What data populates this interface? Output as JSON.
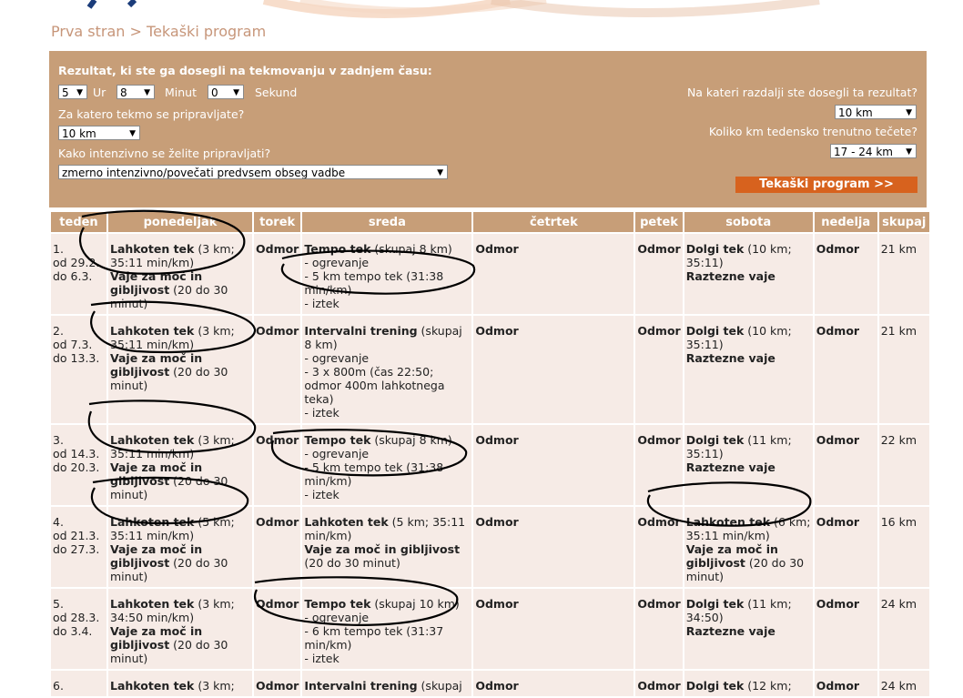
{
  "breadcrumb": {
    "home": "Prva stran",
    "separator": ">",
    "current": "Tekaški program"
  },
  "form": {
    "question_result": "Rezultat, ki ste ga dosegli na tekmovanju v zadnjem času:",
    "hours_value": "5",
    "hours_label": "Ur",
    "minutes_value": "8",
    "minutes_label": "Minut",
    "seconds_value": "0",
    "seconds_label": "Sekund",
    "question_race": "Za katero tekmo se pripravljate?",
    "race_value": "10 km",
    "question_intensity": "Kako intenzivno se želite pripravljati?",
    "intensity_value": "zmerno intenzivno/povečati predvsem obseg vadbe",
    "question_distance": "Na kateri razdalji ste dosegli ta rezultat?",
    "distance_value": "10 km",
    "question_weekly": "Koliko km tedensko trenutno tečete?",
    "weekly_value": "17 - 24 km",
    "submit_label": "Tekaški program >>"
  },
  "table": {
    "headers": [
      "teden",
      "ponedeljak",
      "torek",
      "sreda",
      "četrtek",
      "petek",
      "sobota",
      "nedelja",
      "skupaj"
    ],
    "rows": [
      {
        "week": [
          "1.",
          "od 29.2.",
          "do 6.3."
        ],
        "mon": [
          {
            "b": "Lahkoten tek",
            "t": " (3 km; 35:11 min/km)"
          },
          {
            "b": "Vaje za moč in gibljivost",
            "t": " (20 do 30 minut)"
          }
        ],
        "tue": [
          {
            "b": "Odmor",
            "t": ""
          }
        ],
        "wed": [
          {
            "b": "Tempo tek",
            "t": " (skupaj 8 km)"
          },
          {
            "b": "",
            "t": "- ogrevanje"
          },
          {
            "b": "",
            "t": "- 5 km tempo tek (31:38 min/km)"
          },
          {
            "b": "",
            "t": "- iztek"
          }
        ],
        "thu": [
          {
            "b": "Odmor",
            "t": ""
          }
        ],
        "fri": [
          {
            "b": "Odmor",
            "t": ""
          }
        ],
        "sat": [
          {
            "b": "Dolgi tek",
            "t": " (10 km; 35:11)"
          },
          {
            "b": "Raztezne vaje",
            "t": ""
          }
        ],
        "sun": [
          {
            "b": "Odmor",
            "t": ""
          }
        ],
        "total": "21 km"
      },
      {
        "week": [
          "2.",
          "od 7.3.",
          "do 13.3."
        ],
        "mon": [
          {
            "b": "Lahkoten tek",
            "t": " (3 km; 35:11 min/km)"
          },
          {
            "b": "Vaje za moč in gibljivost",
            "t": " (20 do 30 minut)"
          }
        ],
        "tue": [
          {
            "b": "Odmor",
            "t": ""
          }
        ],
        "wed": [
          {
            "b": "Intervalni trening",
            "t": " (skupaj 8 km)"
          },
          {
            "b": "",
            "t": "- ogrevanje"
          },
          {
            "b": "",
            "t": "- 3 x 800m (čas 22:50; odmor 400m lahkotnega teka)"
          },
          {
            "b": "",
            "t": "- iztek"
          }
        ],
        "thu": [
          {
            "b": "Odmor",
            "t": ""
          }
        ],
        "fri": [
          {
            "b": "Odmor",
            "t": ""
          }
        ],
        "sat": [
          {
            "b": "Dolgi tek",
            "t": " (10 km; 35:11)"
          },
          {
            "b": "Raztezne vaje",
            "t": ""
          }
        ],
        "sun": [
          {
            "b": "Odmor",
            "t": ""
          }
        ],
        "total": "21 km"
      },
      {
        "week": [
          "3.",
          "od 14.3.",
          "do 20.3."
        ],
        "mon": [
          {
            "b": "Lahkoten tek",
            "t": " (3 km; 35:11 min/km)"
          },
          {
            "b": "Vaje za moč in gibljivost",
            "t": " (20 do 30 minut)"
          }
        ],
        "tue": [
          {
            "b": "Odmor",
            "t": ""
          }
        ],
        "wed": [
          {
            "b": "Tempo tek",
            "t": " (skupaj 8 km)"
          },
          {
            "b": "",
            "t": "- ogrevanje"
          },
          {
            "b": "",
            "t": "- 5 km tempo tek (31:38 min/km)"
          },
          {
            "b": "",
            "t": "- iztek"
          }
        ],
        "thu": [
          {
            "b": "Odmor",
            "t": ""
          }
        ],
        "fri": [
          {
            "b": "Odmor",
            "t": ""
          }
        ],
        "sat": [
          {
            "b": "Dolgi tek",
            "t": " (11 km; 35:11)"
          },
          {
            "b": "Raztezne vaje",
            "t": ""
          }
        ],
        "sun": [
          {
            "b": "Odmor",
            "t": ""
          }
        ],
        "total": "22 km"
      },
      {
        "week": [
          "4.",
          "od 21.3.",
          "do 27.3."
        ],
        "mon": [
          {
            "b": "Lahkoten tek",
            "t": " (5 km; 35:11 min/km)"
          },
          {
            "b": "Vaje za moč in gibljivost",
            "t": " (20 do 30 minut)"
          }
        ],
        "tue": [
          {
            "b": "Odmor",
            "t": ""
          }
        ],
        "wed": [
          {
            "b": "Lahkoten tek",
            "t": " (5 km; 35:11 min/km)"
          },
          {
            "b": "Vaje za moč in gibljivost",
            "t": ""
          },
          {
            "b": "",
            "t": "(20 do 30 minut)"
          }
        ],
        "thu": [
          {
            "b": "Odmor",
            "t": ""
          }
        ],
        "fri": [
          {
            "b": "Odmor",
            "t": ""
          }
        ],
        "sat": [
          {
            "b": "Lahkoten tek",
            "t": " (6 km; 35:11 min/km)"
          },
          {
            "b": "Vaje za moč in gibljivost",
            "t": " (20 do 30 minut)"
          }
        ],
        "sun": [
          {
            "b": "Odmor",
            "t": ""
          }
        ],
        "total": "16 km"
      },
      {
        "week": [
          "5.",
          "od 28.3.",
          "do 3.4."
        ],
        "mon": [
          {
            "b": "Lahkoten tek",
            "t": " (3 km; 34:50 min/km)"
          },
          {
            "b": "Vaje za moč in gibljivost",
            "t": " (20 do 30 minut)"
          }
        ],
        "tue": [
          {
            "b": "Odmor",
            "t": ""
          }
        ],
        "wed": [
          {
            "b": "Tempo tek",
            "t": " (skupaj 10 km)"
          },
          {
            "b": "",
            "t": "- ogrevanje"
          },
          {
            "b": "",
            "t": "- 6 km tempo tek (31:37 min/km)"
          },
          {
            "b": "",
            "t": "- iztek"
          }
        ],
        "thu": [
          {
            "b": "Odmor",
            "t": ""
          }
        ],
        "fri": [
          {
            "b": "Odmor",
            "t": ""
          }
        ],
        "sat": [
          {
            "b": "Dolgi tek",
            "t": " (11 km; 34:50)"
          },
          {
            "b": "Raztezne vaje",
            "t": ""
          }
        ],
        "sun": [
          {
            "b": "Odmor",
            "t": ""
          }
        ],
        "total": "24 km"
      },
      {
        "week": [
          "6."
        ],
        "mon": [
          {
            "b": "Lahkoten tek",
            "t": " (3 km;"
          }
        ],
        "tue": [
          {
            "b": "Odmor",
            "t": ""
          }
        ],
        "wed": [
          {
            "b": "Intervalni trening",
            "t": " (skupaj"
          }
        ],
        "thu": [
          {
            "b": "Odmor",
            "t": ""
          }
        ],
        "fri": [
          {
            "b": "Odmor",
            "t": ""
          }
        ],
        "sat": [
          {
            "b": "Dolgi tek",
            "t": " (12 km;"
          }
        ],
        "sun": [
          {
            "b": "Odmor",
            "t": ""
          }
        ],
        "total": "24 km"
      }
    ]
  },
  "colors": {
    "panel": "#c79e78",
    "button": "#d7621e",
    "cell": "#f6ebe6",
    "breadcrumb": "#c7967a"
  }
}
